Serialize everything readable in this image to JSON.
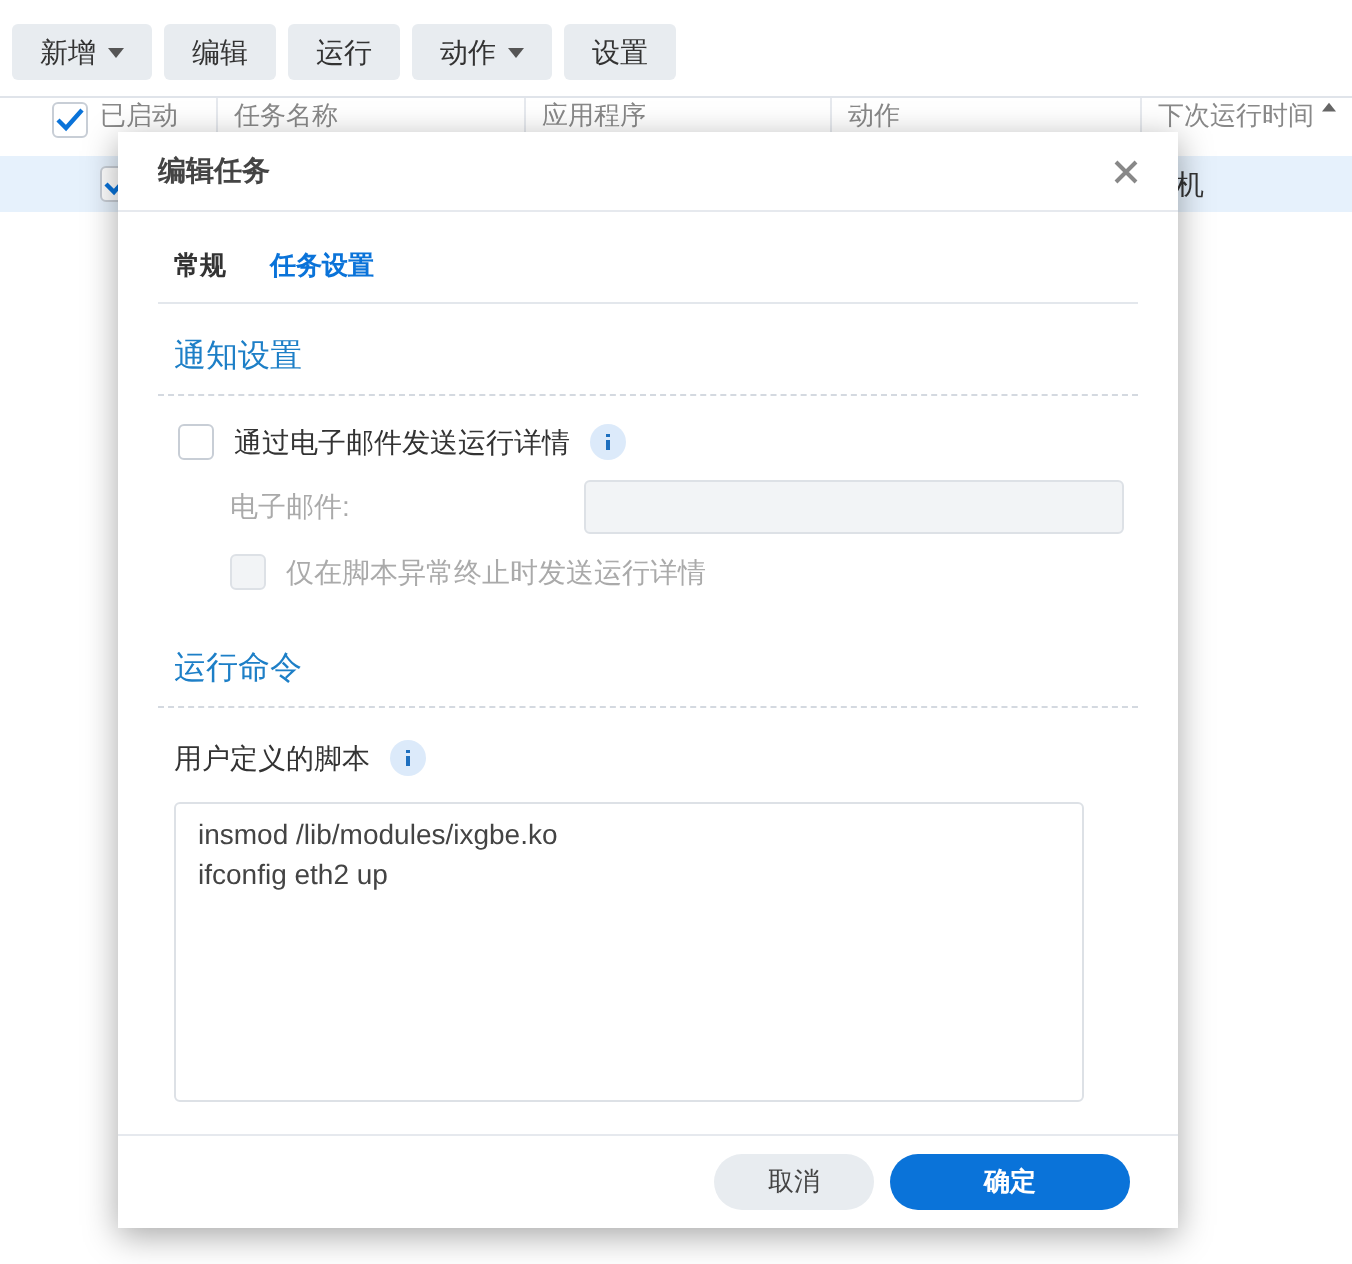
{
  "toolbar": [
    {
      "label": "新增",
      "dropdown": true
    },
    {
      "label": "编辑",
      "dropdown": false
    },
    {
      "label": "运行",
      "dropdown": false
    },
    {
      "label": "动作",
      "dropdown": true
    },
    {
      "label": "设置",
      "dropdown": false
    }
  ],
  "table": {
    "columns": [
      {
        "label": "已启动",
        "checked": true
      },
      {
        "label": "任务名称"
      },
      {
        "label": "应用程序"
      },
      {
        "label": "动作"
      },
      {
        "label": "下次运行时间",
        "sorted": true
      }
    ],
    "rows": [
      {
        "checked": true,
        "selected": true,
        "column_5": "机"
      }
    ]
  },
  "dialog": {
    "title": "编辑任务",
    "tabs": [
      {
        "label": "常规",
        "selected": false
      },
      {
        "label": "任务设置",
        "selected": true
      }
    ],
    "notification": {
      "heading": "通知设置",
      "email_option": {
        "label": "通过电子邮件发送运行详情",
        "checked": false
      },
      "email_label": "电子邮件:",
      "abnormal_option": {
        "label": "仅在脚本异常终止时发送运行详情",
        "checked": false,
        "disabled": true
      }
    },
    "command": {
      "heading": "运行命令",
      "script_label": "用户定义的脚本",
      "script": "insmod /lib/modules/ixgbe.ko\nifconfig eth2 up"
    },
    "buttons": [
      {
        "label": "取消",
        "kind": "secondary"
      },
      {
        "label": "确定",
        "kind": "primary"
      }
    ]
  }
}
